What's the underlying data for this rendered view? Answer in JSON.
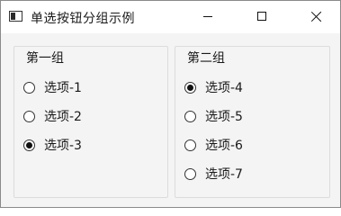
{
  "window": {
    "title": "单选按钮分组示例",
    "app_icon": "window-app-icon",
    "controls": {
      "minimize_icon": "minimize-icon",
      "maximize_icon": "maximize-icon",
      "close_icon": "close-icon"
    }
  },
  "groups": [
    {
      "title": "第一组",
      "options": [
        {
          "label": "选项-1",
          "checked": false
        },
        {
          "label": "选项-2",
          "checked": false
        },
        {
          "label": "选项-3",
          "checked": true
        }
      ]
    },
    {
      "title": "第二组",
      "options": [
        {
          "label": "选项-4",
          "checked": true
        },
        {
          "label": "选项-5",
          "checked": false
        },
        {
          "label": "选项-6",
          "checked": false
        },
        {
          "label": "选项-7",
          "checked": false
        }
      ]
    }
  ]
}
